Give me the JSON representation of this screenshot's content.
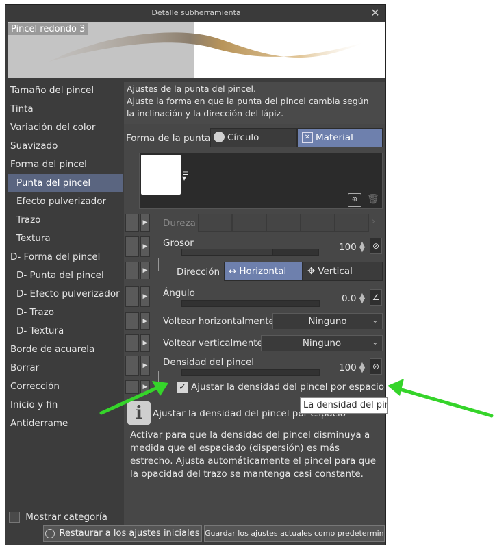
{
  "window": {
    "title": "Detalle subherramienta",
    "close_icon": "close-icon"
  },
  "preview": {
    "brush_name": "Pincel redondo 3"
  },
  "sidebar": {
    "items": [
      {
        "label": "Tamaño del pincel",
        "sub": false,
        "active": false
      },
      {
        "label": "Tinta",
        "sub": false,
        "active": false
      },
      {
        "label": "Variación del color",
        "sub": false,
        "active": false
      },
      {
        "label": "Suavizado",
        "sub": false,
        "active": false
      },
      {
        "label": "Forma del pincel",
        "sub": false,
        "active": false
      },
      {
        "label": "Punta del pincel",
        "sub": true,
        "active": true
      },
      {
        "label": "Efecto pulverizador",
        "sub": true,
        "active": false
      },
      {
        "label": "Trazo",
        "sub": true,
        "active": false
      },
      {
        "label": "Textura",
        "sub": true,
        "active": false
      },
      {
        "label": "D- Forma del pincel",
        "sub": false,
        "active": false
      },
      {
        "label": "D- Punta del pincel",
        "sub": true,
        "active": false
      },
      {
        "label": "D- Efecto pulverizador",
        "sub": true,
        "active": false
      },
      {
        "label": "D- Trazo",
        "sub": true,
        "active": false
      },
      {
        "label": "D- Textura",
        "sub": true,
        "active": false
      },
      {
        "label": "Borde de acuarela",
        "sub": false,
        "active": false
      },
      {
        "label": "Borrar",
        "sub": false,
        "active": false
      },
      {
        "label": "Corrección",
        "sub": false,
        "active": false
      },
      {
        "label": "Inicio y fin",
        "sub": false,
        "active": false
      },
      {
        "label": "Antiderrame",
        "sub": false,
        "active": false
      }
    ]
  },
  "main": {
    "description": {
      "line1": "Ajustes de la punta del pincel.",
      "line2": "Ajuste la forma en que la punta del pincel cambia según",
      "line3": "la inclinación y la dirección del lápiz."
    },
    "tip_shape": {
      "label": "Forma de la punta",
      "option_circle": "Círculo",
      "option_material": "Material",
      "selected": "Material"
    },
    "hardness": {
      "label": "Dureza"
    },
    "thickness": {
      "label": "Grosor",
      "value": "100"
    },
    "direction": {
      "label": "Dirección",
      "option_horizontal": "Horizontal",
      "option_vertical": "Vertical",
      "selected": "Horizontal"
    },
    "angle": {
      "label": "Ángulo",
      "value": "0.0"
    },
    "flip_horizontal": {
      "label": "Voltear horizontalmente",
      "value": "Ninguno"
    },
    "flip_vertical": {
      "label": "Voltear verticalmente",
      "value": "Ninguno"
    },
    "brush_density": {
      "label": "Densidad del pincel",
      "value": "100"
    },
    "adjust_density": {
      "label": "Ajustar la densidad del pincel por espacio",
      "checked": true
    }
  },
  "tooltip": {
    "text": "La densidad del pincel"
  },
  "info": {
    "title": "Ajustar la densidad del pincel por espacio",
    "text": "Activar para que la densidad del pincel disminuya a medida que el espaciado (dispersión) es más estrecho. Ajusta automáticamente el pincel para que la opacidad del trazo se mantenga casi constante."
  },
  "bottom": {
    "show_category_label": "Mostrar categoría",
    "restore_label": "Restaurar a los ajustes iniciales",
    "save_default_label": "Guardar los ajustes actuales como predeterminados"
  },
  "colors": {
    "selected_accent": "#6e80ad",
    "annotation_arrow": "#35d42a"
  }
}
